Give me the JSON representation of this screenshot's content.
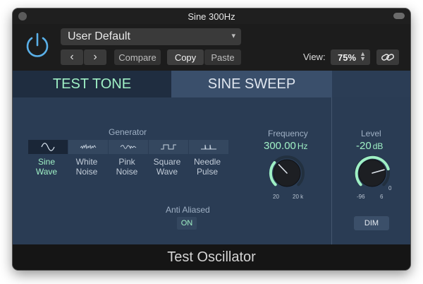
{
  "window": {
    "title": "Sine 300Hz"
  },
  "header": {
    "preset": "User Default",
    "prev_label": "‹",
    "next_label": "›",
    "compare_label": "Compare",
    "copy_label": "Copy",
    "paste_label": "Paste",
    "view_label": "View:",
    "zoom_value": "75%"
  },
  "tabs": [
    {
      "label": "TEST TONE",
      "active": true
    },
    {
      "label": "SINE SWEEP",
      "active": false
    }
  ],
  "generator": {
    "label": "Generator",
    "waves": [
      {
        "label": "Sine Wave",
        "line1": "Sine",
        "line2": "Wave",
        "icon": "sine-wave-icon",
        "selected": true
      },
      {
        "label": "White Noise",
        "line1": "White",
        "line2": "Noise",
        "icon": "white-noise-icon",
        "selected": false
      },
      {
        "label": "Pink Noise",
        "line1": "Pink",
        "line2": "Noise",
        "icon": "pink-noise-icon",
        "selected": false
      },
      {
        "label": "Square Wave",
        "line1": "Square",
        "line2": "Wave",
        "icon": "square-wave-icon",
        "selected": false
      },
      {
        "label": "Needle Pulse",
        "line1": "Needle",
        "line2": "Pulse",
        "icon": "needle-pulse-icon",
        "selected": false
      }
    ]
  },
  "anti_aliased": {
    "label": "Anti Aliased",
    "value": "ON"
  },
  "frequency": {
    "label": "Frequency",
    "value": "300.00",
    "unit": "Hz",
    "min_label": "20",
    "max_label": "20 k"
  },
  "level": {
    "label": "Level",
    "value": "-20",
    "unit": "dB",
    "min_label": "-96",
    "max_label": "6",
    "zero_label": "0",
    "dim_label": "DIM"
  },
  "footer": {
    "plugin_name": "Test Oscillator"
  },
  "colors": {
    "accent": "#9ff0c5",
    "panel": "#2a3c54",
    "power": "#5ab0e8"
  }
}
